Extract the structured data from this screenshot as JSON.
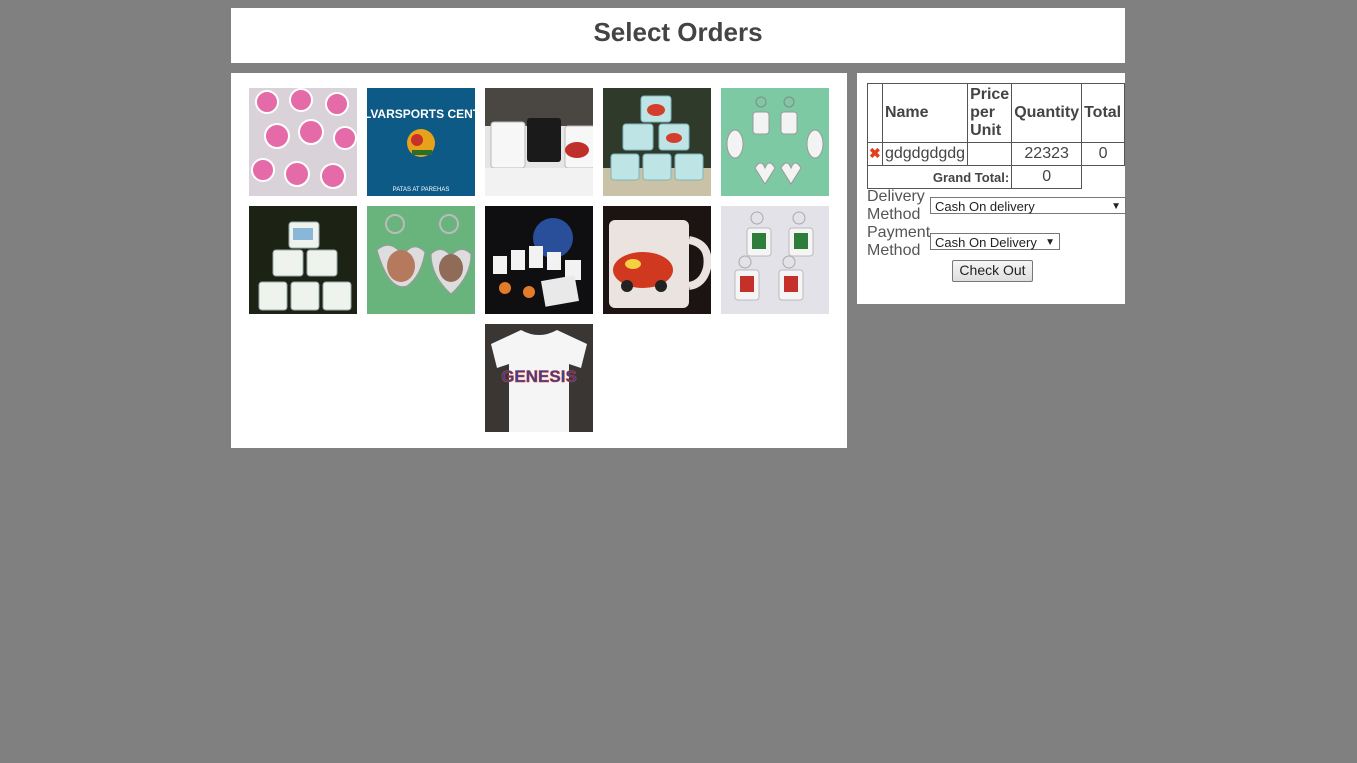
{
  "page": {
    "title": "Select Orders"
  },
  "gallery": {
    "items": [
      {
        "name": "keychains-pink",
        "caption": ""
      },
      {
        "name": "malvarsports-shirt",
        "caption": "MALVARSPORTS CENTER"
      },
      {
        "name": "white-black-mugs",
        "caption": ""
      },
      {
        "name": "stacked-mugs-cars",
        "caption": ""
      },
      {
        "name": "keychains-green-bg",
        "caption": ""
      },
      {
        "name": "mugs-pyramid",
        "caption": ""
      },
      {
        "name": "heart-butterfly-keychains",
        "caption": ""
      },
      {
        "name": "assorted-souvenirs",
        "caption": ""
      },
      {
        "name": "cars-mug",
        "caption": ""
      },
      {
        "name": "photo-keychains",
        "caption": ""
      },
      {
        "name": "genesis-tshirt",
        "caption": "GENESIS"
      }
    ],
    "shirt_small_text": "PATAS AT PAREHAS"
  },
  "cart": {
    "headers": {
      "name": "Name",
      "price": "Price per Unit",
      "quantity": "Quantity",
      "total": "Total"
    },
    "rows": [
      {
        "delete_icon": "✖",
        "name": "gdgdgdgdg",
        "price": "",
        "quantity": "22323",
        "total": "0"
      }
    ],
    "grand_total_label": "Grand Total:",
    "grand_total_value": "0"
  },
  "form": {
    "delivery_label": "Delivery Method",
    "delivery_value": "Cash On delivery",
    "payment_label": "Payment Method",
    "payment_value": "Cash On Delivery",
    "checkout_label": "Check Out"
  },
  "colors": {
    "background": "#808080",
    "panel": "#ffffff",
    "grand_total": "#c8102e",
    "delete_icon": "#e2401f"
  }
}
